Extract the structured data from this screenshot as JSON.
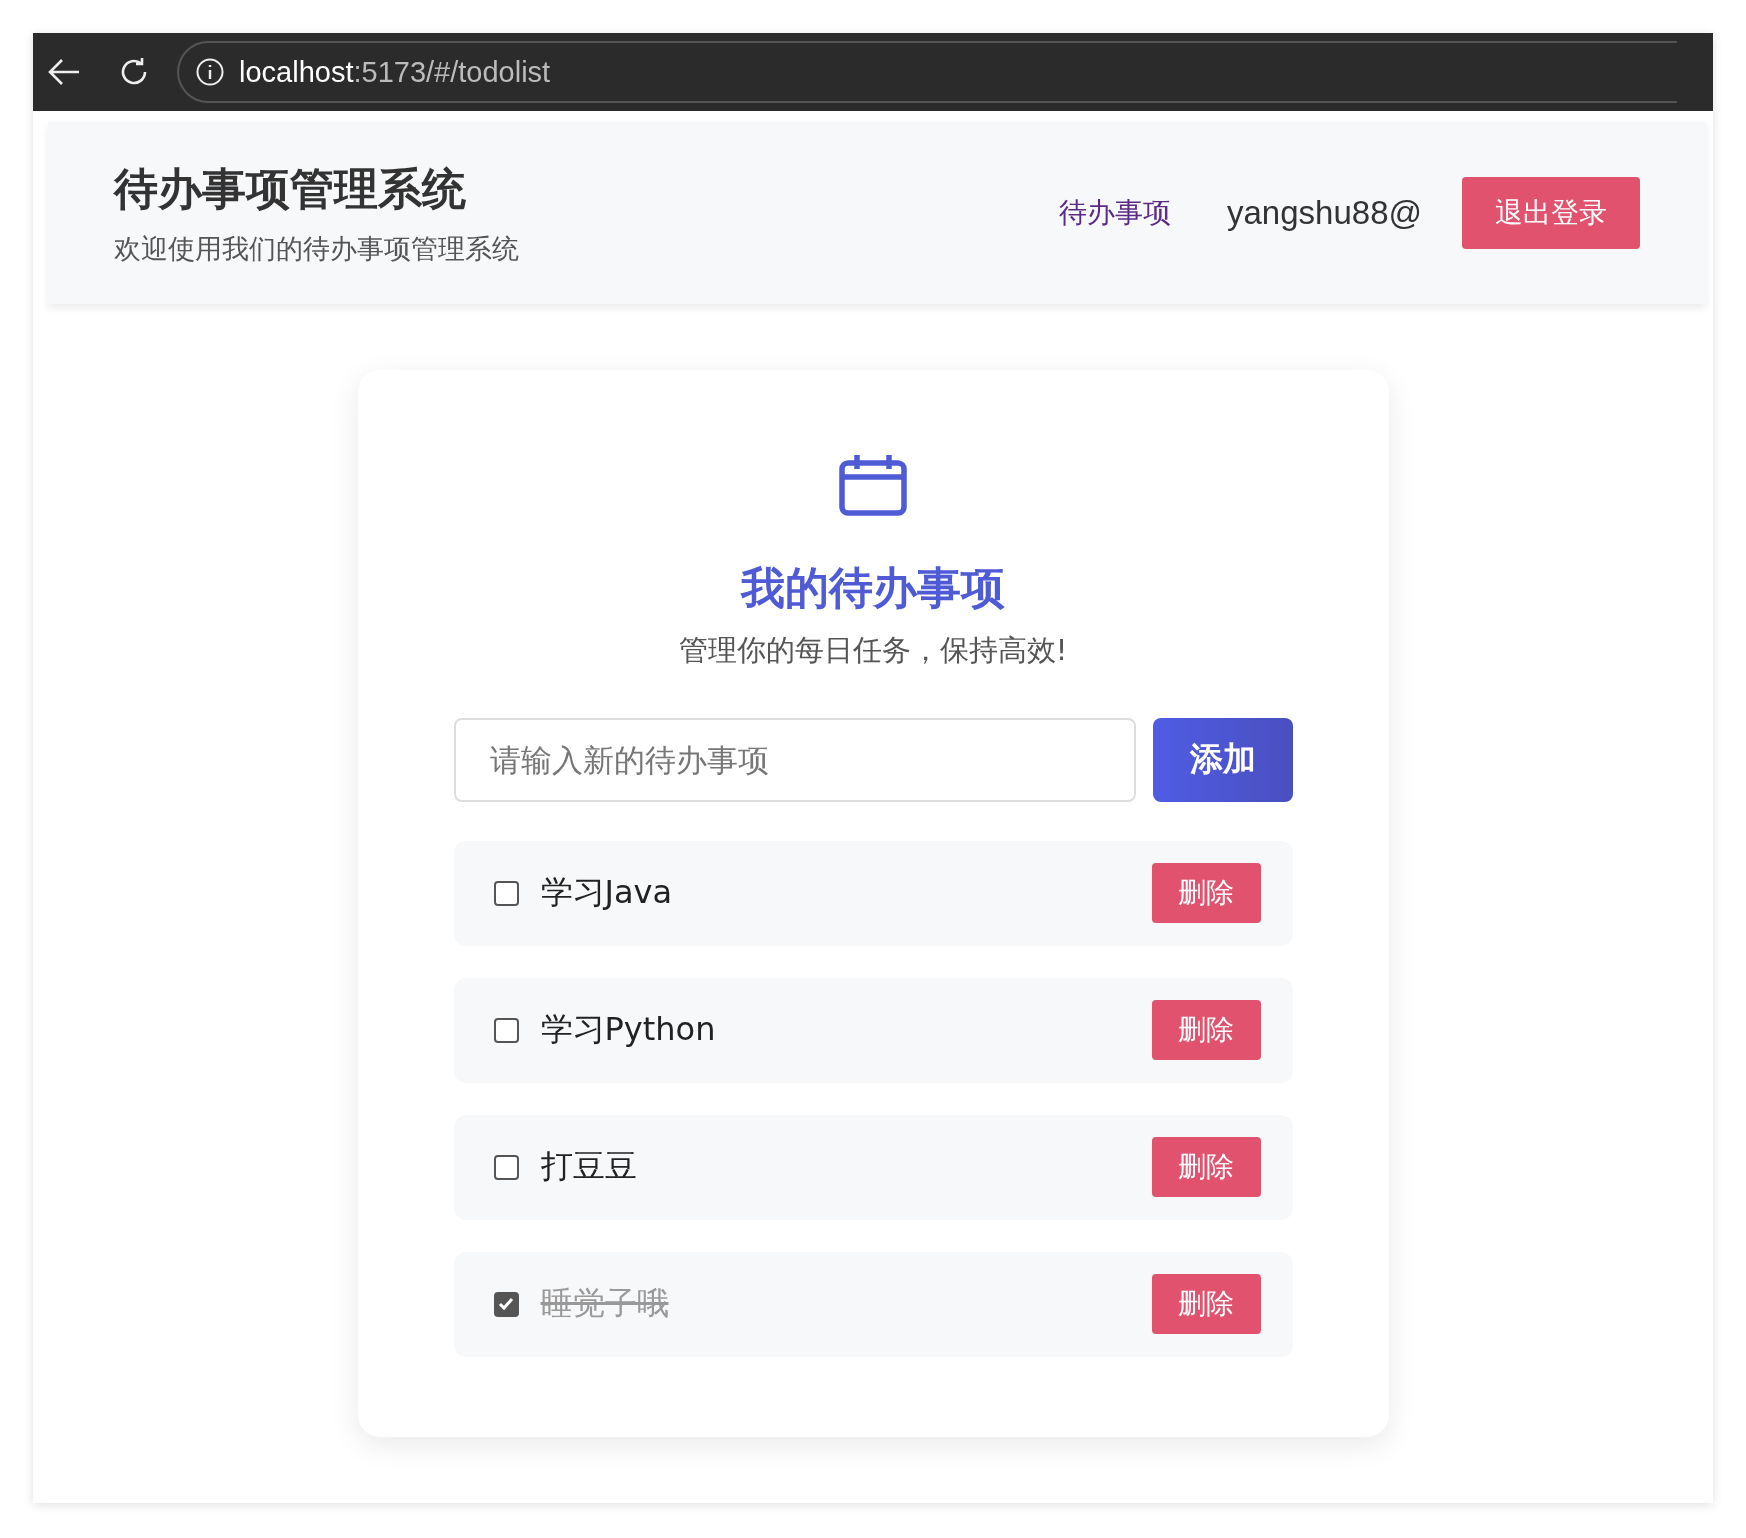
{
  "browser": {
    "url_host": "localhost",
    "url_path": ":5173/#/todolist"
  },
  "header": {
    "title": "待办事项管理系统",
    "subtitle": "欢迎使用我们的待办事项管理系统",
    "nav_link": "待办事项",
    "user": "yangshu88@",
    "logout_button": "退出登录"
  },
  "card": {
    "title": "我的待办事项",
    "subtitle": "管理你的每日任务，保持高效!",
    "input": {
      "placeholder": "请输入新的待办事项"
    },
    "add_button": "添加",
    "todos": [
      {
        "text": "学习Java",
        "checked": false,
        "delete_button": "删除"
      },
      {
        "text": "学习Python",
        "checked": false,
        "delete_button": "删除"
      },
      {
        "text": "打豆豆",
        "checked": false,
        "delete_button": "删除"
      },
      {
        "text": "睡觉子哦",
        "checked": true,
        "delete_button": "删除"
      }
    ]
  }
}
